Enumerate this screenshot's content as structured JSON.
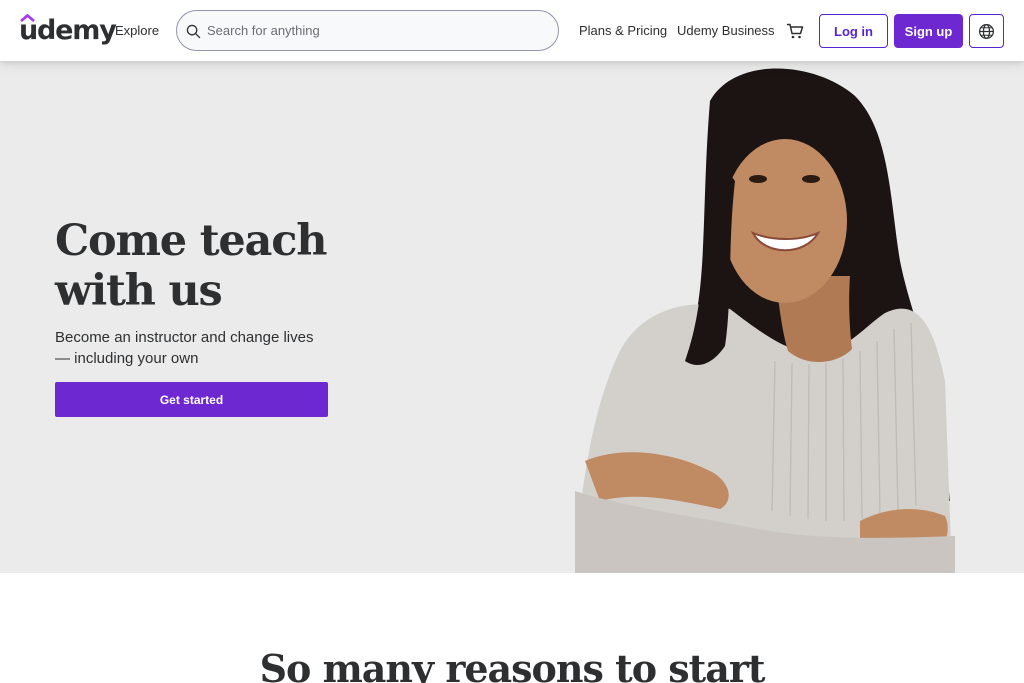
{
  "header": {
    "logo_text": "udemy",
    "explore_label": "Explore",
    "search": {
      "placeholder": "Search for anything",
      "value": ""
    },
    "plans_label": "Plans & Pricing",
    "business_label": "Udemy Business",
    "login_label": "Log in",
    "signup_label": "Sign up"
  },
  "hero": {
    "title": "Come teach with us",
    "subtitle": "Become an instructor and change lives — including your own",
    "cta_label": "Get started"
  },
  "reasons": {
    "title": "So many reasons to start"
  },
  "colors": {
    "brand_purple": "#6d28d2",
    "accent_purple": "#5624d0",
    "hero_bg": "#ebebeb",
    "text": "#2d2f31"
  },
  "icons": [
    "udemy-logo-mark",
    "search-icon",
    "cart-icon",
    "globe-icon"
  ]
}
